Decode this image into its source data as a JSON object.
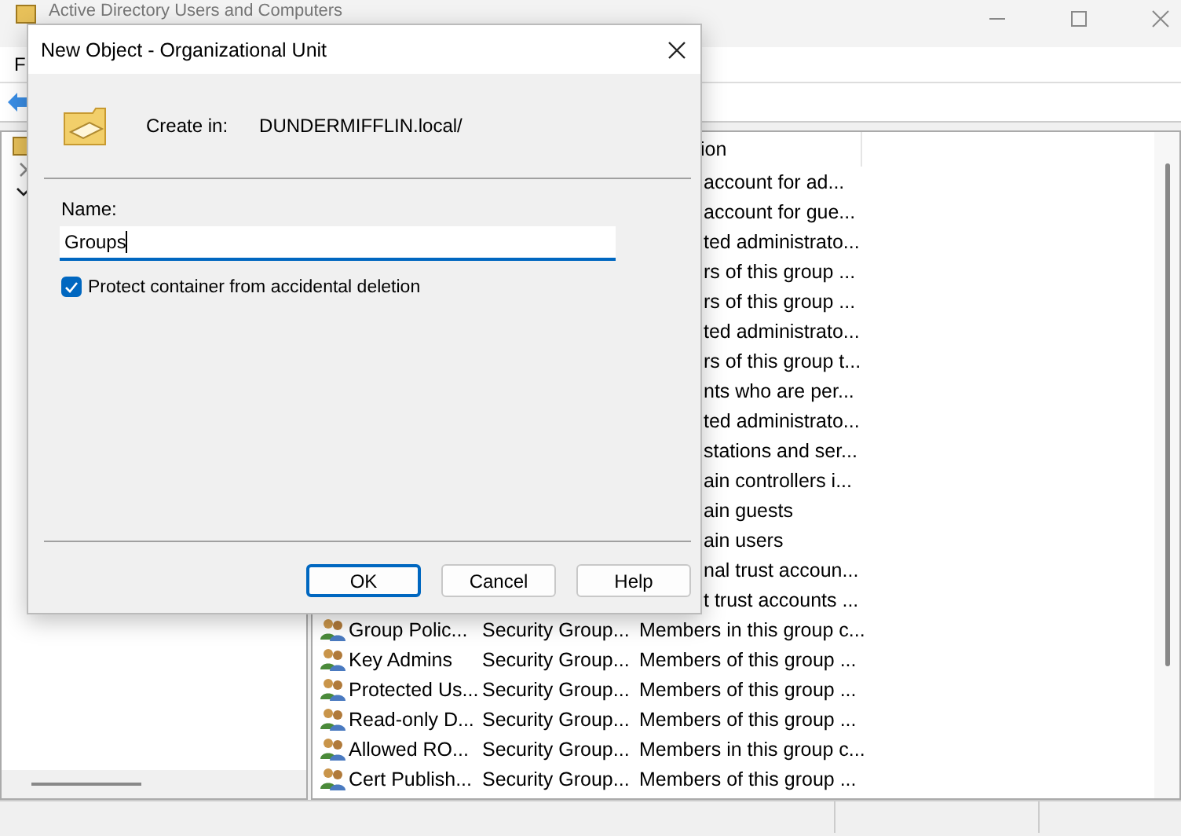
{
  "window": {
    "title": "Active Directory Users and Computers",
    "menu": [
      "F"
    ]
  },
  "tree": [
    {
      "expanded": false
    },
    {
      "expanded": true
    }
  ],
  "list": {
    "header": "ion",
    "rows": [
      {
        "kind": "partial",
        "description": "account for ad..."
      },
      {
        "kind": "partial",
        "description": "account for gue..."
      },
      {
        "kind": "partial",
        "description": "ted administrato..."
      },
      {
        "kind": "partial",
        "description": "rs of this group ..."
      },
      {
        "kind": "partial",
        "description": "rs of this group ..."
      },
      {
        "kind": "partial",
        "description": "ted administrato..."
      },
      {
        "kind": "partial",
        "description": "rs of this group t..."
      },
      {
        "kind": "partial",
        "description": "nts who are per..."
      },
      {
        "kind": "partial",
        "description": "ted administrato..."
      },
      {
        "kind": "partial",
        "description": "stations and ser..."
      },
      {
        "kind": "partial",
        "description": "ain controllers i..."
      },
      {
        "kind": "partial",
        "description": "ain guests"
      },
      {
        "kind": "partial",
        "description": "ain users"
      },
      {
        "kind": "partial",
        "description": "nal trust accoun..."
      },
      {
        "kind": "partial",
        "description": "t trust accounts ..."
      },
      {
        "kind": "group",
        "name": "Group Polic...",
        "type": "Security Group...",
        "description": "Members in this group c..."
      },
      {
        "kind": "group",
        "name": "Key Admins",
        "type": "Security Group...",
        "description": "Members of this group ..."
      },
      {
        "kind": "group",
        "name": "Protected Us...",
        "type": "Security Group...",
        "description": "Members of this group ..."
      },
      {
        "kind": "group",
        "name": "Read-only D...",
        "type": "Security Group...",
        "description": "Members of this group ..."
      },
      {
        "kind": "group",
        "name": "Allowed RO...",
        "type": "Security Group...",
        "description": "Members in this group c..."
      },
      {
        "kind": "group",
        "name": "Cert Publish...",
        "type": "Security Group...",
        "description": "Members of this group ..."
      }
    ]
  },
  "dialog": {
    "title": "New Object - Organizational Unit",
    "create_in_label": "Create in:",
    "create_in_path": "DUNDERMIFFLIN.local/",
    "name_label": "Name:",
    "name_value": "Groups",
    "protect": {
      "label": "Protect container from accidental deletion",
      "checked": true
    },
    "buttons": [
      {
        "label": "OK",
        "default": true
      },
      {
        "label": "Cancel",
        "default": false
      },
      {
        "label": "Help",
        "default": false
      }
    ]
  }
}
